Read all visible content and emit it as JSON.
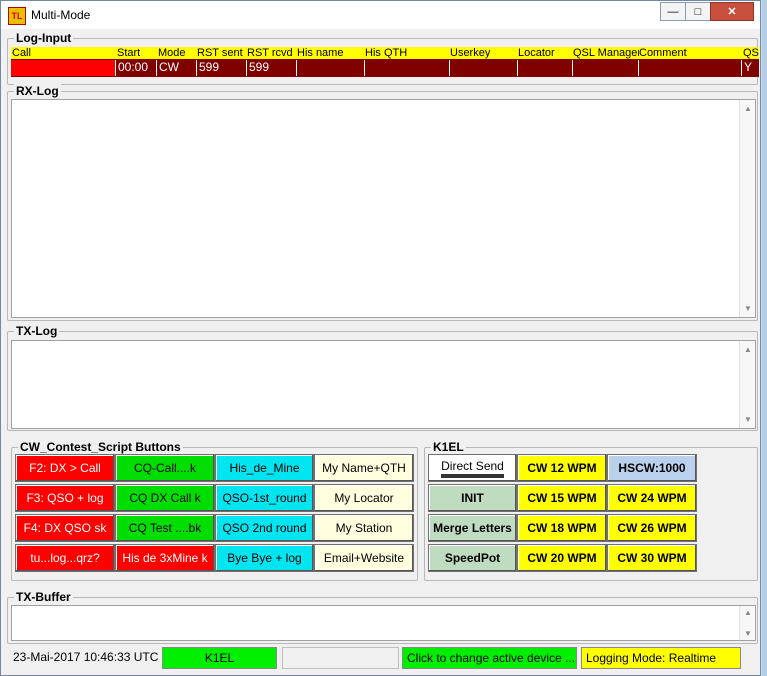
{
  "window": {
    "title": "Multi-Mode",
    "icon": "app-logo-icon",
    "controls": [
      "minimize-icon",
      "maximize-icon",
      "close-icon"
    ]
  },
  "log_input": {
    "label": "Log-Input",
    "columns": [
      "Call",
      "Start",
      "Mode",
      "RST sent",
      "RST rcvd",
      "His name",
      "His QTH",
      "Userkey",
      "Locator",
      "QSL Manager",
      "Comment",
      "QS"
    ],
    "values": [
      "",
      "00:00",
      "CW",
      "599",
      "599",
      "",
      "",
      "",
      "",
      "",
      "",
      "Y"
    ]
  },
  "rx_log": {
    "label": "RX-Log"
  },
  "tx_log": {
    "label": "TX-Log"
  },
  "cw_buttons": {
    "label": "CW_Contest_Script Buttons",
    "rows": [
      [
        "F2: DX > Call",
        "CQ-Call....k",
        "His_de_Mine",
        "My Name+QTH"
      ],
      [
        "F3: QSO + log",
        "CQ DX Call k",
        "QSO-1st_round",
        "My Locator"
      ],
      [
        "F4: DX QSO sk",
        "CQ Test ....bk",
        "QSO 2nd round",
        "My Station"
      ],
      [
        "tu...log...qrz?",
        "His de 3xMine k",
        "Bye Bye + log",
        "Email+Website"
      ]
    ]
  },
  "keyer": {
    "label": "K1EL",
    "rows": [
      [
        "Direct Send",
        "CW 12 WPM",
        "HSCW:1000"
      ],
      [
        "INIT",
        "CW 15 WPM",
        "CW 24 WPM"
      ],
      [
        "Merge Letters",
        "CW 18 WPM",
        "CW 26 WPM"
      ],
      [
        "SpeedPot",
        "CW 20 WPM",
        "CW 30 WPM"
      ]
    ]
  },
  "tx_buffer": {
    "label": "TX-Buffer"
  },
  "statusbar": {
    "datetime": "23-Mai-2017  10:46:33 UTC",
    "device": "K1EL",
    "blank": "",
    "hint": "Click to change active device ...",
    "logging": "Logging Mode: Realtime"
  },
  "colors": {
    "red": "#ff0000",
    "green": "#00dd00",
    "cyan": "#00e5f0",
    "cream": "#ffffe0",
    "yellow": "#ffff00",
    "sage": "#c0dcc0",
    "blue": "#b9d1ea",
    "maroon": "#800000"
  }
}
